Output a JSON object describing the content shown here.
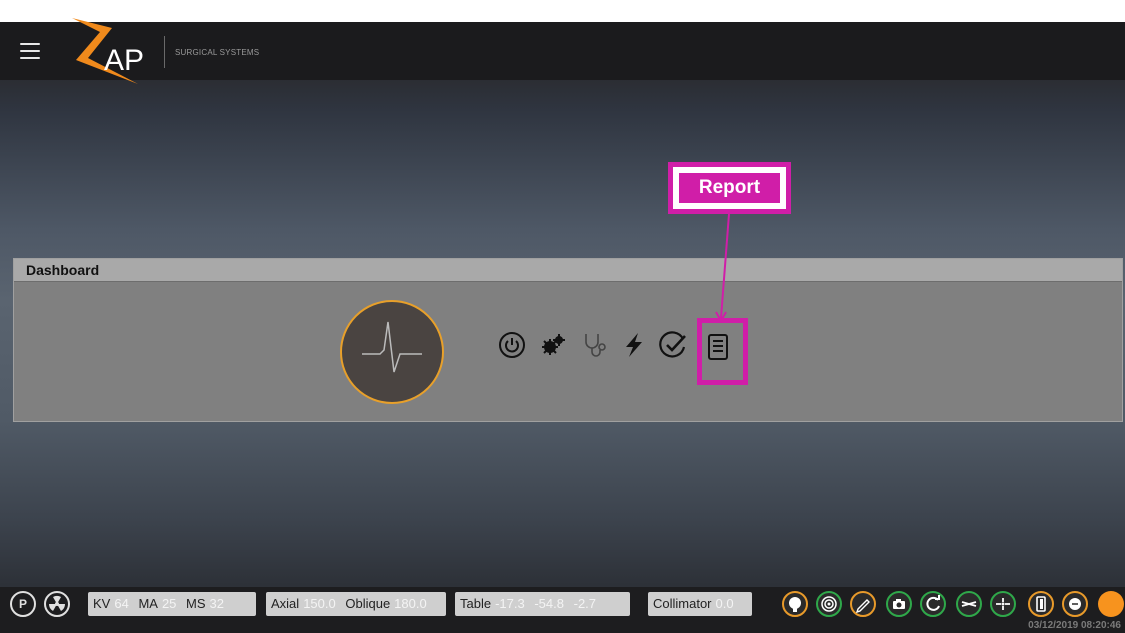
{
  "header": {
    "brand": "AP",
    "brand_sub": "SURGICAL SYSTEMS"
  },
  "dashboard": {
    "title": "Dashboard",
    "icons": [
      "power-icon",
      "gears-icon",
      "stethoscope-icon",
      "lightning-icon",
      "check-circle-icon",
      "report-icon"
    ]
  },
  "callout": {
    "label": "Report"
  },
  "statusbar": {
    "p_button": "P",
    "kv_label": "KV",
    "kv_value": "64",
    "ma_label": "MA",
    "ma_value": "25",
    "ms_label": "MS",
    "ms_value": "32",
    "axial_label": "Axial",
    "axial_value": "150.0",
    "oblique_label": "Oblique",
    "oblique_value": "180.0",
    "table_label": "Table",
    "table_x": "-17.3",
    "table_y": "-54.8",
    "table_z": "-2.7",
    "collimator_label": "Collimator",
    "collimator_value": "0.0",
    "datetime": "03/12/2019 08:20:46"
  },
  "colors": {
    "accent_orange": "#e89a2a",
    "accent_green": "#2fa84a",
    "highlight_magenta": "#d01ea8",
    "status_led": "#f7931e"
  }
}
